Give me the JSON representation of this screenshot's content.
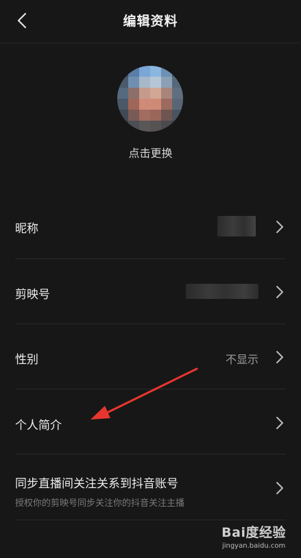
{
  "header": {
    "title": "编辑资料"
  },
  "avatar": {
    "change_label": "点击更换"
  },
  "rows": [
    {
      "label": "昵称",
      "value": ""
    },
    {
      "label": "剪映号",
      "value": ""
    },
    {
      "label": "性别",
      "value": "不显示"
    },
    {
      "label": "个人简介",
      "value": ""
    },
    {
      "label": "同步直播间关注关系到抖音账号",
      "subtitle": "授权你的剪映号同步关注你的抖音关注主播"
    }
  ],
  "icons": {
    "back": "chevron-left-icon",
    "row_arrow": "chevron-right-icon",
    "annotation": "red-arrow-icon"
  },
  "colors": {
    "background": "#171717",
    "annotation_arrow": "#e8362f"
  },
  "watermark": {
    "logo": "Bai度经验",
    "url": "jingyan.baidu.com"
  }
}
